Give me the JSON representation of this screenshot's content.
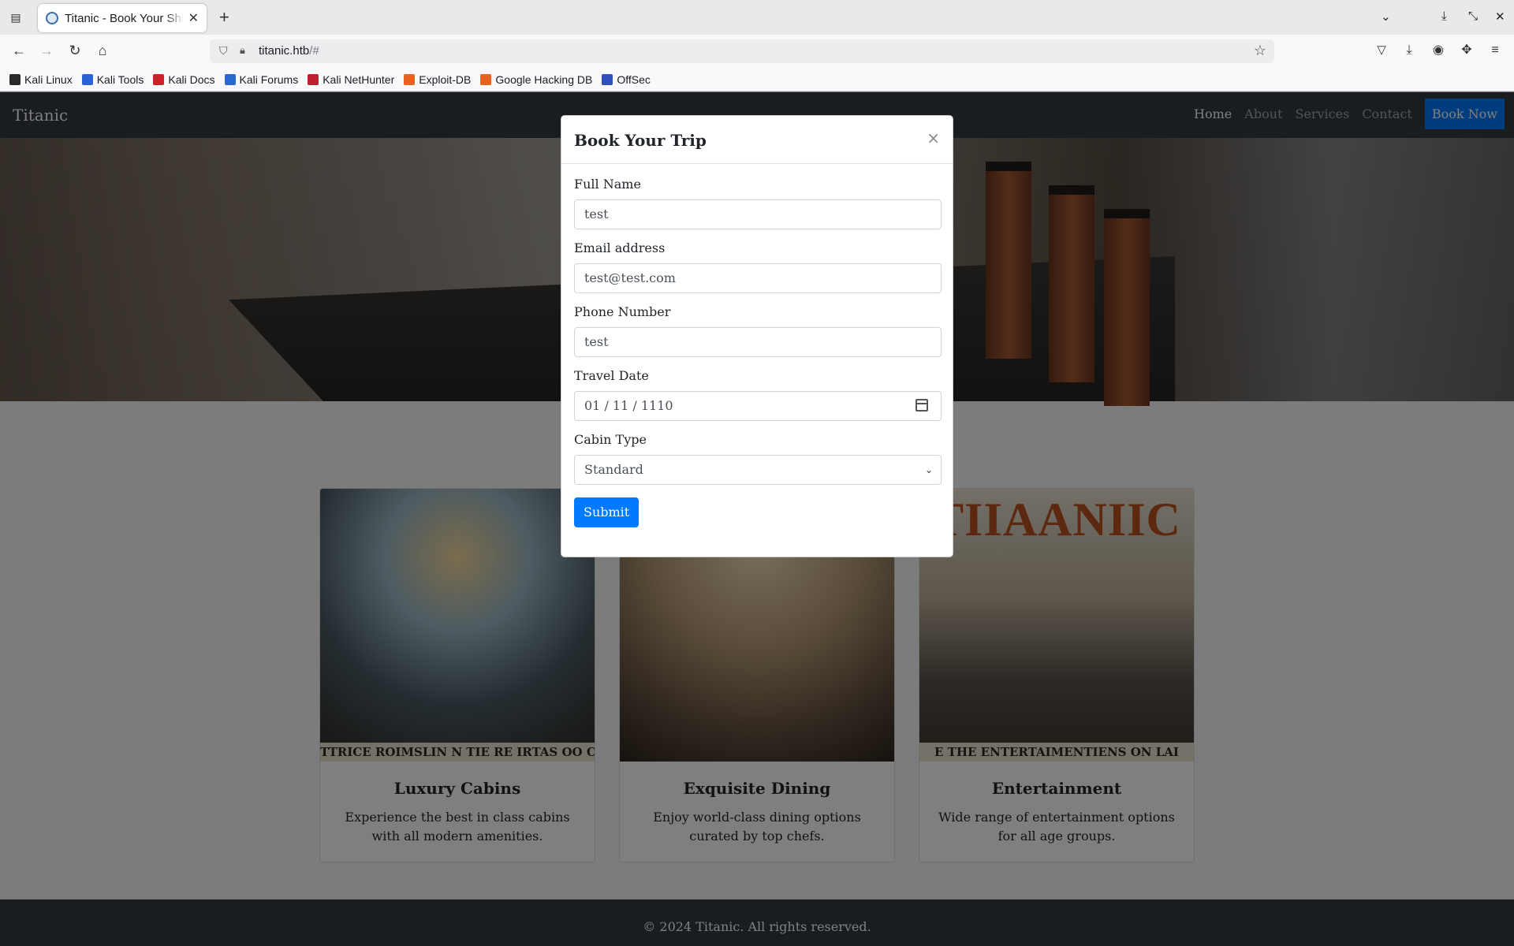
{
  "browser": {
    "tab_title": "Titanic - Book Your Ship Trip",
    "url_host": "titanic.htb",
    "url_path": "/#",
    "bookmarks": [
      {
        "label": "Kali Linux",
        "color": "#2a2a2a"
      },
      {
        "label": "Kali Tools",
        "color": "#2a62d8"
      },
      {
        "label": "Kali Docs",
        "color": "#d0202a"
      },
      {
        "label": "Kali Forums",
        "color": "#2a6ad0"
      },
      {
        "label": "Kali NetHunter",
        "color": "#c02030"
      },
      {
        "label": "Exploit-DB",
        "color": "#e8641e"
      },
      {
        "label": "Google Hacking DB",
        "color": "#e8641e"
      },
      {
        "label": "OffSec",
        "color": "#3050c0"
      }
    ]
  },
  "site": {
    "brand": "Titanic",
    "nav": [
      "Home",
      "About",
      "Services",
      "Contact"
    ],
    "book_now": "Book Now"
  },
  "cards": [
    {
      "title": "Luxury Cabins",
      "text": "Experience the best in class cabins with all modern amenities.",
      "image_banner": "TTRICE ROIMSLIN N TIE RE IRTAS OO CRAS I"
    },
    {
      "title": "Exquisite Dining",
      "text": "Enjoy world-class dining options curated by top chefs."
    },
    {
      "title": "Entertainment",
      "text": "Wide range of entertainment options for all age groups.",
      "image_title": "TIIAANIIC",
      "image_banner": "E THE ENTERTAIMENTIENS ON LAI"
    }
  ],
  "footer": "© 2024 Titanic. All rights reserved.",
  "modal": {
    "title": "Book Your Trip",
    "close": "×",
    "fields": {
      "name_label": "Full Name",
      "name_value": "test",
      "email_label": "Email address",
      "email_value": "test@test.com",
      "phone_label": "Phone Number",
      "phone_value": "test",
      "date_label": "Travel Date",
      "date_value": "01 / 11 / 1110",
      "cabin_label": "Cabin Type",
      "cabin_value": "Standard"
    },
    "submit": "Submit"
  },
  "colors": {
    "primary": "#007bff",
    "navbar": "#343a40"
  }
}
